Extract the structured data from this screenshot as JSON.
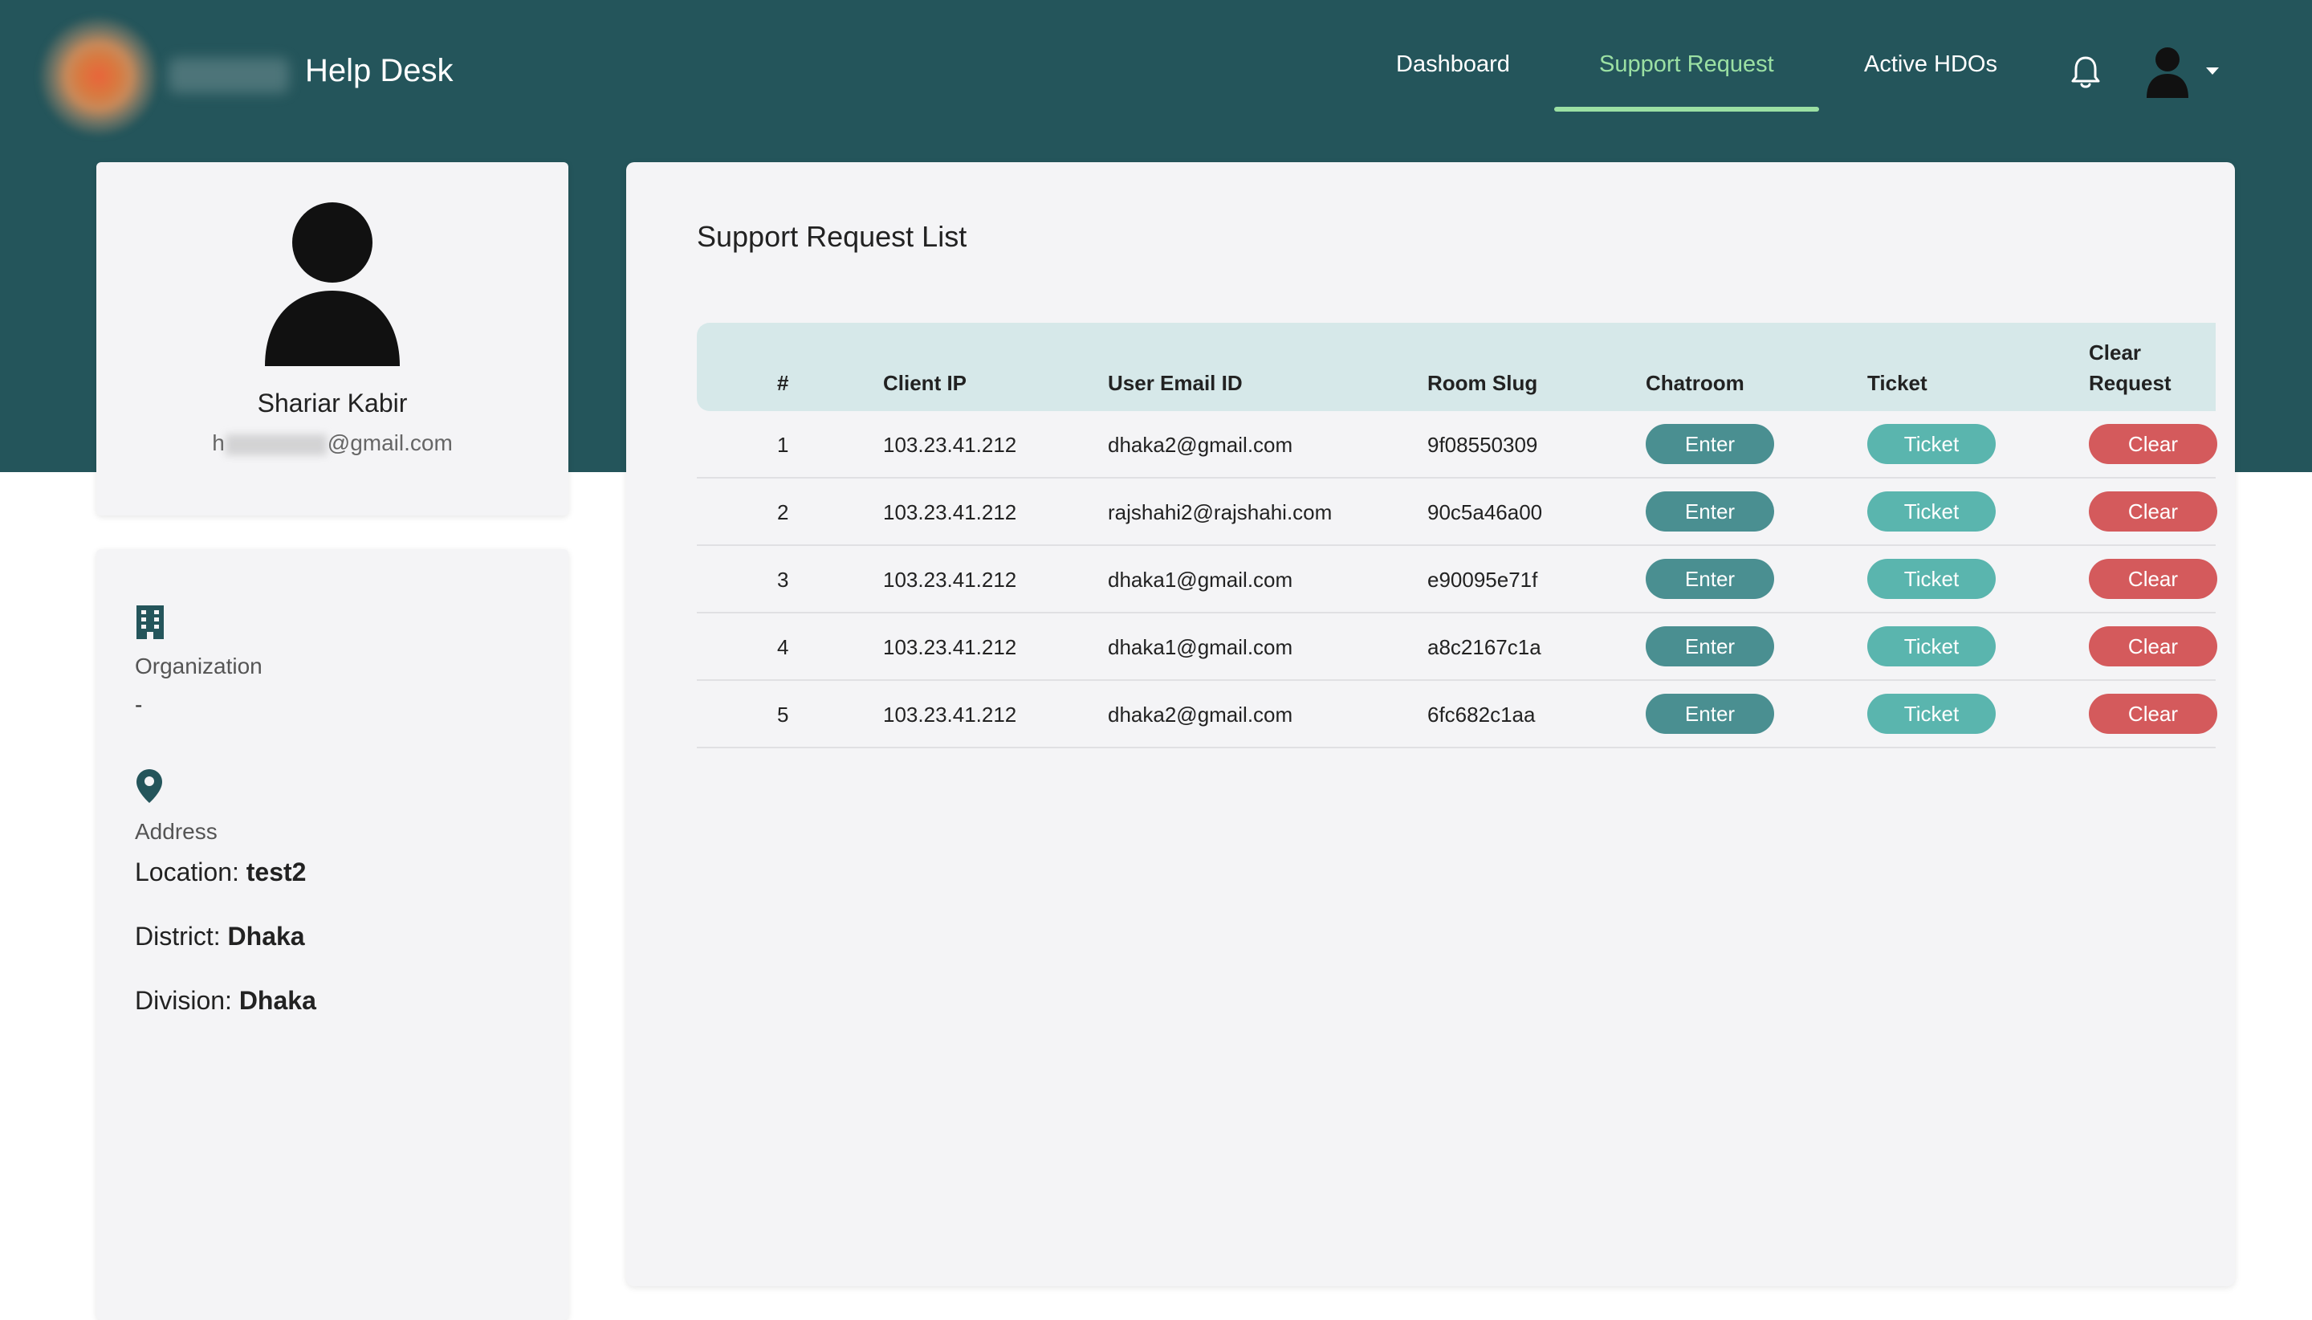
{
  "header": {
    "brand": "Help Desk",
    "nav": [
      {
        "label": "Dashboard"
      },
      {
        "label": "Support Request",
        "active": true
      },
      {
        "label": "Active HDOs"
      }
    ],
    "icons": {
      "notifications": "bell-icon",
      "user": "user-avatar-icon",
      "dropdown": "caret-down-icon"
    }
  },
  "profile": {
    "name": "Shariar Kabir",
    "email_prefix": "h",
    "email_suffix": "@gmail.com"
  },
  "info": {
    "organization_label": "Organization",
    "organization_value": "-",
    "address_label": "Address",
    "location_label": "Location:",
    "location_value": "test2",
    "district_label": "District:",
    "district_value": "Dhaka",
    "division_label": "Division:",
    "division_value": "Dhaka"
  },
  "main": {
    "title": "Support Request List",
    "columns": {
      "index": "#",
      "client_ip": "Client IP",
      "email": "User Email ID",
      "room_slug": "Room Slug",
      "chatroom": "Chatroom",
      "ticket": "Ticket",
      "clear_line1": "Clear",
      "clear_line2": "Request"
    },
    "rows": [
      {
        "index": "1",
        "client_ip": "103.23.41.212",
        "email": "dhaka2@gmail.com",
        "room_slug": "9f08550309",
        "enter": "Enter",
        "ticket": "Ticket",
        "clear": "Clear"
      },
      {
        "index": "2",
        "client_ip": "103.23.41.212",
        "email": "rajshahi2@rajshahi.com",
        "room_slug": "90c5a46a00",
        "enter": "Enter",
        "ticket": "Ticket",
        "clear": "Clear"
      },
      {
        "index": "3",
        "client_ip": "103.23.41.212",
        "email": "dhaka1@gmail.com",
        "room_slug": "e90095e71f",
        "enter": "Enter",
        "ticket": "Ticket",
        "clear": "Clear"
      },
      {
        "index": "4",
        "client_ip": "103.23.41.212",
        "email": "dhaka1@gmail.com",
        "room_slug": "a8c2167c1a",
        "enter": "Enter",
        "ticket": "Ticket",
        "clear": "Clear"
      },
      {
        "index": "5",
        "client_ip": "103.23.41.212",
        "email": "dhaka2@gmail.com",
        "room_slug": "6fc682c1aa",
        "enter": "Enter",
        "ticket": "Ticket",
        "clear": "Clear"
      }
    ]
  },
  "colors": {
    "header_bg": "#24555b",
    "active_nav": "#9be0a3",
    "enter_button": "#4a8f91",
    "ticket_button": "#5ab5ae",
    "clear_button": "#d45a5c",
    "table_header_bg": "#d6e8e9"
  }
}
